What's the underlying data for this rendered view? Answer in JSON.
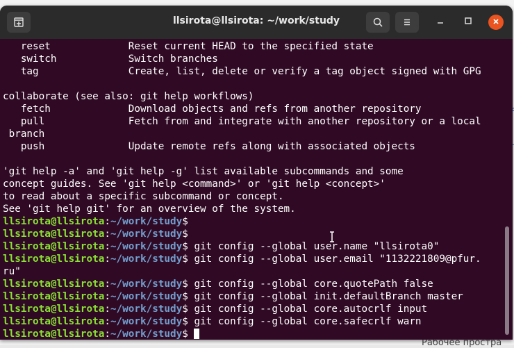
{
  "window": {
    "title": "llsirota@llsirota: ~/work/study"
  },
  "titlebar_icons": {
    "new_tab": "new-tab-icon",
    "search": "search-icon",
    "menu": "hamburger-menu-icon",
    "minimize": "minimize-icon",
    "maximize": "maximize-icon",
    "close": "close-icon"
  },
  "colors": {
    "terminal_bg": "#300a24",
    "prompt_user": "#8ae234",
    "prompt_path": "#729fcf",
    "close_button": "#e95420"
  },
  "terminal": {
    "lines": [
      {
        "kind": "text",
        "text": "   reset             Reset current HEAD to the specified state"
      },
      {
        "kind": "text",
        "text": "   switch            Switch branches"
      },
      {
        "kind": "text",
        "text": "   tag               Create, list, delete or verify a tag object signed with GPG"
      },
      {
        "kind": "text",
        "text": ""
      },
      {
        "kind": "text",
        "text": "collaborate (see also: git help workflows)"
      },
      {
        "kind": "text",
        "text": "   fetch             Download objects and refs from another repository"
      },
      {
        "kind": "text",
        "text": "   pull              Fetch from and integrate with another repository or a local"
      },
      {
        "kind": "text",
        "text": " branch"
      },
      {
        "kind": "text",
        "text": "   push              Update remote refs along with associated objects"
      },
      {
        "kind": "text",
        "text": ""
      },
      {
        "kind": "text",
        "text": "'git help -a' and 'git help -g' list available subcommands and some"
      },
      {
        "kind": "text",
        "text": "concept guides. See 'git help <command>' or 'git help <concept>'"
      },
      {
        "kind": "text",
        "text": "to read about a specific subcommand or concept."
      },
      {
        "kind": "text",
        "text": "See 'git help git' for an overview of the system."
      },
      {
        "kind": "prompt",
        "user": "llsirota@llsirota",
        "sep": ":",
        "path": "~/work/study",
        "sign": "$",
        "cmd": ""
      },
      {
        "kind": "prompt",
        "user": "llsirota@llsirota",
        "sep": ":",
        "path": "~/work/study",
        "sign": "$",
        "cmd": ""
      },
      {
        "kind": "prompt",
        "user": "llsirota@llsirota",
        "sep": ":",
        "path": "~/work/study",
        "sign": "$",
        "cmd": " git config --global user.name \"llsirota0\""
      },
      {
        "kind": "prompt",
        "user": "llsirota@llsirota",
        "sep": ":",
        "path": "~/work/study",
        "sign": "$",
        "cmd": " git config --global user.email \"1132221809@pfur."
      },
      {
        "kind": "text",
        "text": "ru\""
      },
      {
        "kind": "prompt",
        "user": "llsirota@llsirota",
        "sep": ":",
        "path": "~/work/study",
        "sign": "$",
        "cmd": " git config --global core.quotePath false"
      },
      {
        "kind": "prompt",
        "user": "llsirota@llsirota",
        "sep": ":",
        "path": "~/work/study",
        "sign": "$",
        "cmd": " git config --global init.defaultBranch master"
      },
      {
        "kind": "prompt",
        "user": "llsirota@llsirota",
        "sep": ":",
        "path": "~/work/study",
        "sign": "$",
        "cmd": " git config --global core.autocrlf input"
      },
      {
        "kind": "prompt",
        "user": "llsirota@llsirota",
        "sep": ":",
        "path": "~/work/study",
        "sign": "$",
        "cmd": " git config --global core.safecrlf warn"
      },
      {
        "kind": "prompt",
        "user": "llsirota@llsirota",
        "sep": ":",
        "path": "~/work/study",
        "sign": "$",
        "cmd": " "
      }
    ]
  },
  "background_window": {
    "partial_text": "Рабочее простра"
  }
}
